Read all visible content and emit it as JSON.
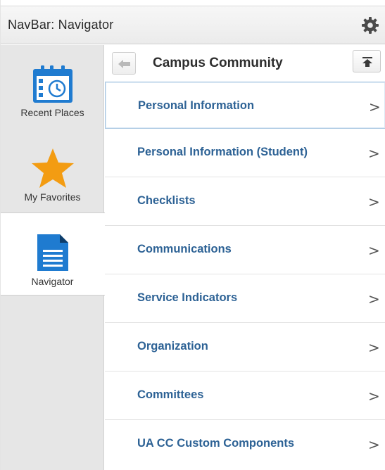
{
  "header": {
    "title": "NavBar: Navigator",
    "settings_icon": "gear-icon"
  },
  "rail": {
    "items": [
      {
        "label": "Recent Places",
        "icon": "calendar-clock-icon",
        "active": false
      },
      {
        "label": "My Favorites",
        "icon": "star-icon",
        "active": false
      },
      {
        "label": "Navigator",
        "icon": "document-icon",
        "active": true
      }
    ]
  },
  "breadcrumb": {
    "title": "Campus Community",
    "back_icon": "back-arrow-icon",
    "top_icon": "scroll-to-top-icon"
  },
  "menu": {
    "items": [
      {
        "label": "Personal Information"
      },
      {
        "label": "Personal Information (Student)"
      },
      {
        "label": "Checklists"
      },
      {
        "label": "Communications"
      },
      {
        "label": "Service Indicators"
      },
      {
        "label": "Organization"
      },
      {
        "label": "Committees"
      },
      {
        "label": "UA CC Custom Components"
      }
    ],
    "chevron": ">"
  },
  "colors": {
    "link": "#2d6295",
    "accent_blue": "#1f7bd0",
    "star": "#f39c12",
    "rail_bg": "#e6e6e6"
  }
}
